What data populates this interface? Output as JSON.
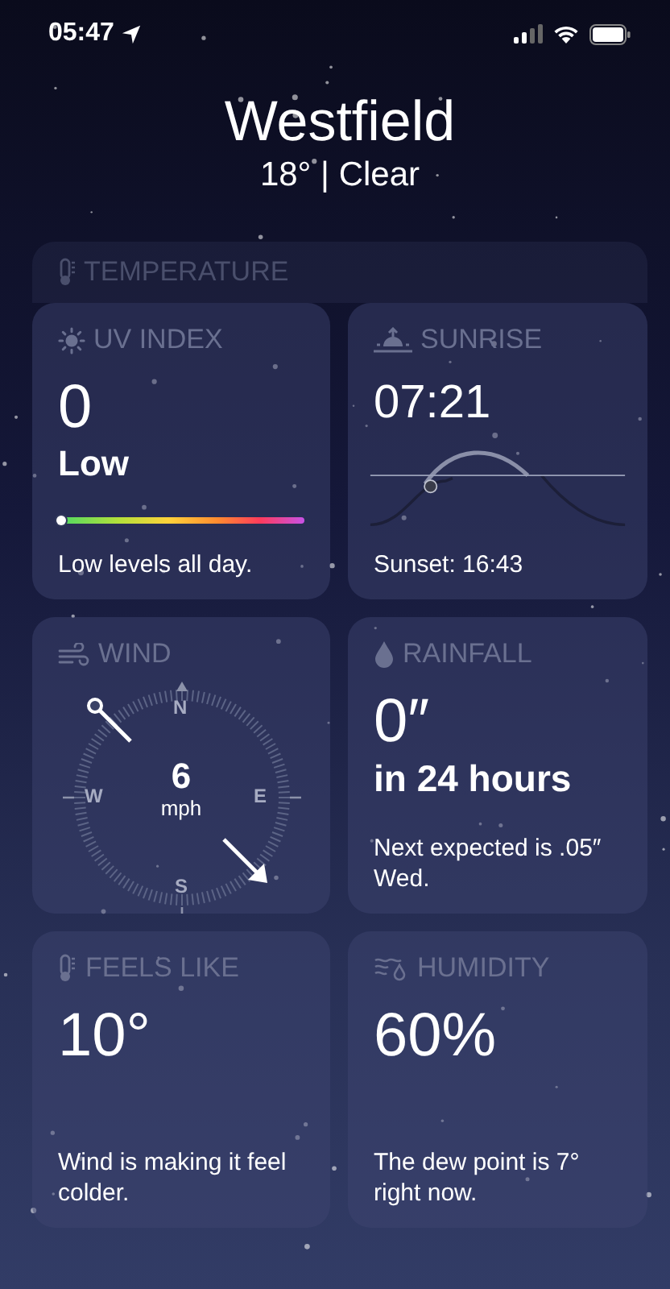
{
  "status_bar": {
    "time": "05:47"
  },
  "location": {
    "city": "Westfield",
    "summary": "18° | Clear"
  },
  "collapsed_section": {
    "title": "TEMPERATURE"
  },
  "tiles": [
    {
      "kind": "uv",
      "title": "UV INDEX",
      "value": "0",
      "label": "Low",
      "level": 0,
      "note": "Low levels all day."
    },
    {
      "kind": "sunrise",
      "title": "SUNRISE",
      "value": "07:21",
      "note": "Sunset: 16:43"
    },
    {
      "kind": "wind",
      "title": "WIND",
      "speed": "6",
      "unit": "mph",
      "compass": [
        "N",
        "E",
        "S",
        "W"
      ]
    },
    {
      "kind": "rainfall",
      "title": "RAINFALL",
      "value": "0″",
      "label": "in 24 hours",
      "note": "Next expected is .05″ Wed."
    },
    {
      "kind": "feels",
      "title": "FEELS LIKE",
      "value": "10°",
      "note": "Wind is making it feel colder."
    },
    {
      "kind": "humidity",
      "title": "HUMIDITY",
      "value": "60%",
      "note": "The dew point is 7° right now."
    }
  ]
}
